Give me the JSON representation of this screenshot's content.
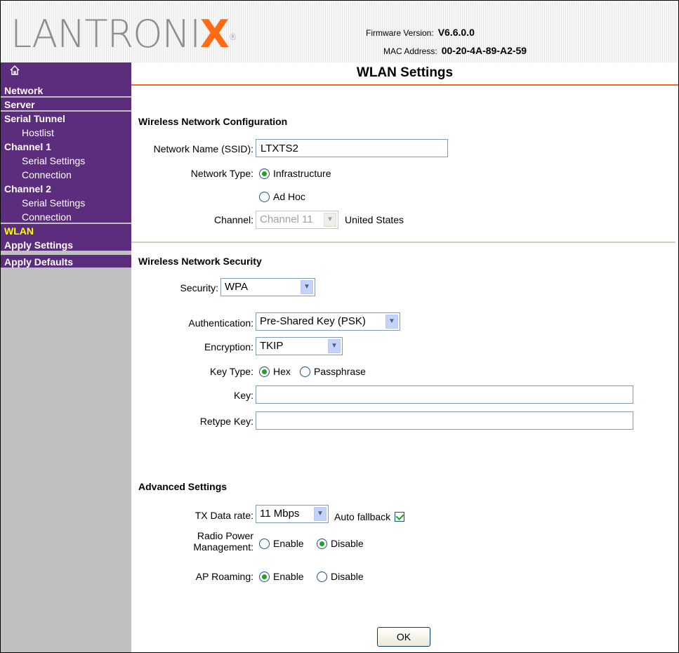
{
  "header": {
    "logo_text": "LANTRONIX",
    "firmware_label": "Firmware Version:",
    "firmware_value": "V6.6.0.0",
    "mac_label": "MAC Address:",
    "mac_value": "00-20-4A-89-A2-59"
  },
  "sidebar": {
    "home_icon": "home-icon",
    "items": [
      {
        "label": "Network"
      },
      {
        "label": "Server"
      },
      {
        "label": "Serial Tunnel"
      },
      {
        "label": "Hostlist"
      },
      {
        "label": "Channel 1"
      },
      {
        "label": "Serial Settings"
      },
      {
        "label": "Connection"
      },
      {
        "label": "Channel 2"
      },
      {
        "label": "Serial Settings"
      },
      {
        "label": "Connection"
      },
      {
        "label": "WLAN"
      },
      {
        "label": "Apply Settings"
      },
      {
        "label": "Apply Defaults"
      }
    ]
  },
  "main": {
    "page_title": "WLAN Settings",
    "wireless_config": {
      "title": "Wireless Network Configuration",
      "ssid_label": "Network Name (SSID):",
      "ssid_value": "LTXTS2",
      "network_type_label": "Network Type:",
      "infrastructure_label": "Infrastructure",
      "adhoc_label": "Ad Hoc",
      "channel_label": "Channel:",
      "channel_value": "Channel 11",
      "region": "United States"
    },
    "security": {
      "title": "Wireless Network Security",
      "security_label": "Security:",
      "security_value": "WPA",
      "auth_label": "Authentication:",
      "auth_value": "Pre-Shared Key (PSK)",
      "encryption_label": "Encryption:",
      "encryption_value": "TKIP",
      "key_type_label": "Key Type:",
      "hex_label": "Hex",
      "passphrase_label": "Passphrase",
      "key_label": "Key:",
      "key_value": "",
      "retype_key_label": "Retype Key:",
      "retype_key_value": ""
    },
    "advanced": {
      "title": "Advanced Settings",
      "tx_rate_label": "TX Data rate:",
      "tx_rate_value": "11 Mbps",
      "auto_fallback_label": "Auto fallback",
      "radio_power_label_1": "Radio Power",
      "radio_power_label_2": "Management:",
      "enable_label": "Enable",
      "disable_label": "Disable",
      "ap_roaming_label": "AP Roaming:"
    },
    "ok_label": "OK"
  }
}
